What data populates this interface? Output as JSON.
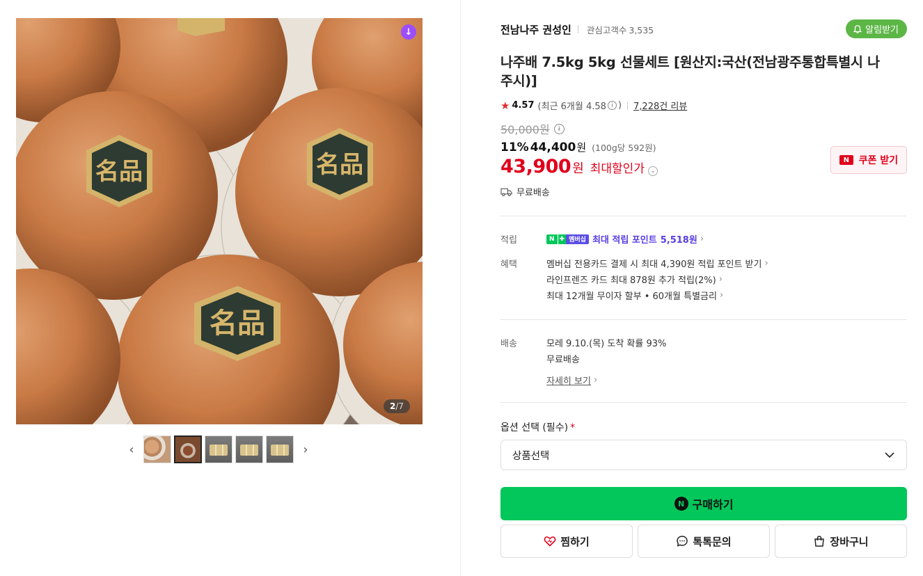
{
  "gallery": {
    "counter_current": "2",
    "counter_total": "/7",
    "badge_icon": "download-icon",
    "prev_glyph": "‹",
    "next_glyph": "›",
    "label_glyph": "名品"
  },
  "seller": {
    "name": "전남나주 권성인",
    "followers_label": "관심고객수",
    "followers_count": "3,535",
    "alarm_label": "알림받기",
    "alarm_color": "#5cb646"
  },
  "product": {
    "title": "나주배 7.5kg 5kg 선물세트 [원산지:국산(전남광주통합특별시 나주시)]",
    "rating_star": "★",
    "rating": "4.57",
    "rating_recent": "(최근 6개월 4.58",
    "rating_recent_close": ")",
    "reviews": "7,228건 리뷰",
    "original_price": "50,000원",
    "discount": "11%",
    "sale_price": "44,400",
    "sale_won": "원",
    "unit_price": "(100g당 592원)",
    "max_price": "43,900",
    "max_won": "원",
    "max_label": "최대할인가",
    "coupon_label": "쿠폰 받기",
    "coupon_icon_text": "N",
    "shipping": "무료배송",
    "accent_red": "#e0001b"
  },
  "benefits": {
    "points_label": "적립",
    "badge_n": "N",
    "badge_plus": "✚",
    "badge_membership": "멤버십",
    "points_text_prefix": "최대 적립 포인트",
    "points_value": "5,518원",
    "perks_label": "혜택",
    "perks": [
      "멤버십 전용카드 결제 시 최대 4,390원 적립 포인트 받기",
      "라인프렌즈 카드 최대 878원 추가 적립(2%)",
      "최대 12개월 무이자 할부 • 60개월 특별금리"
    ]
  },
  "delivery": {
    "label": "배송",
    "arrival": "모레 9.10.(목) 도착 확률 93%",
    "fee": "무료배송",
    "detail_link": "자세히 보기"
  },
  "options": {
    "label": "옵션 선택 (필수)",
    "required_mark": "*",
    "select_value": "상품선택"
  },
  "actions": {
    "buy_logo": "N",
    "buy": "구매하기",
    "buy_color": "#03c75a",
    "wish": "찜하기",
    "talk": "톡톡문의",
    "cart": "장바구니"
  }
}
